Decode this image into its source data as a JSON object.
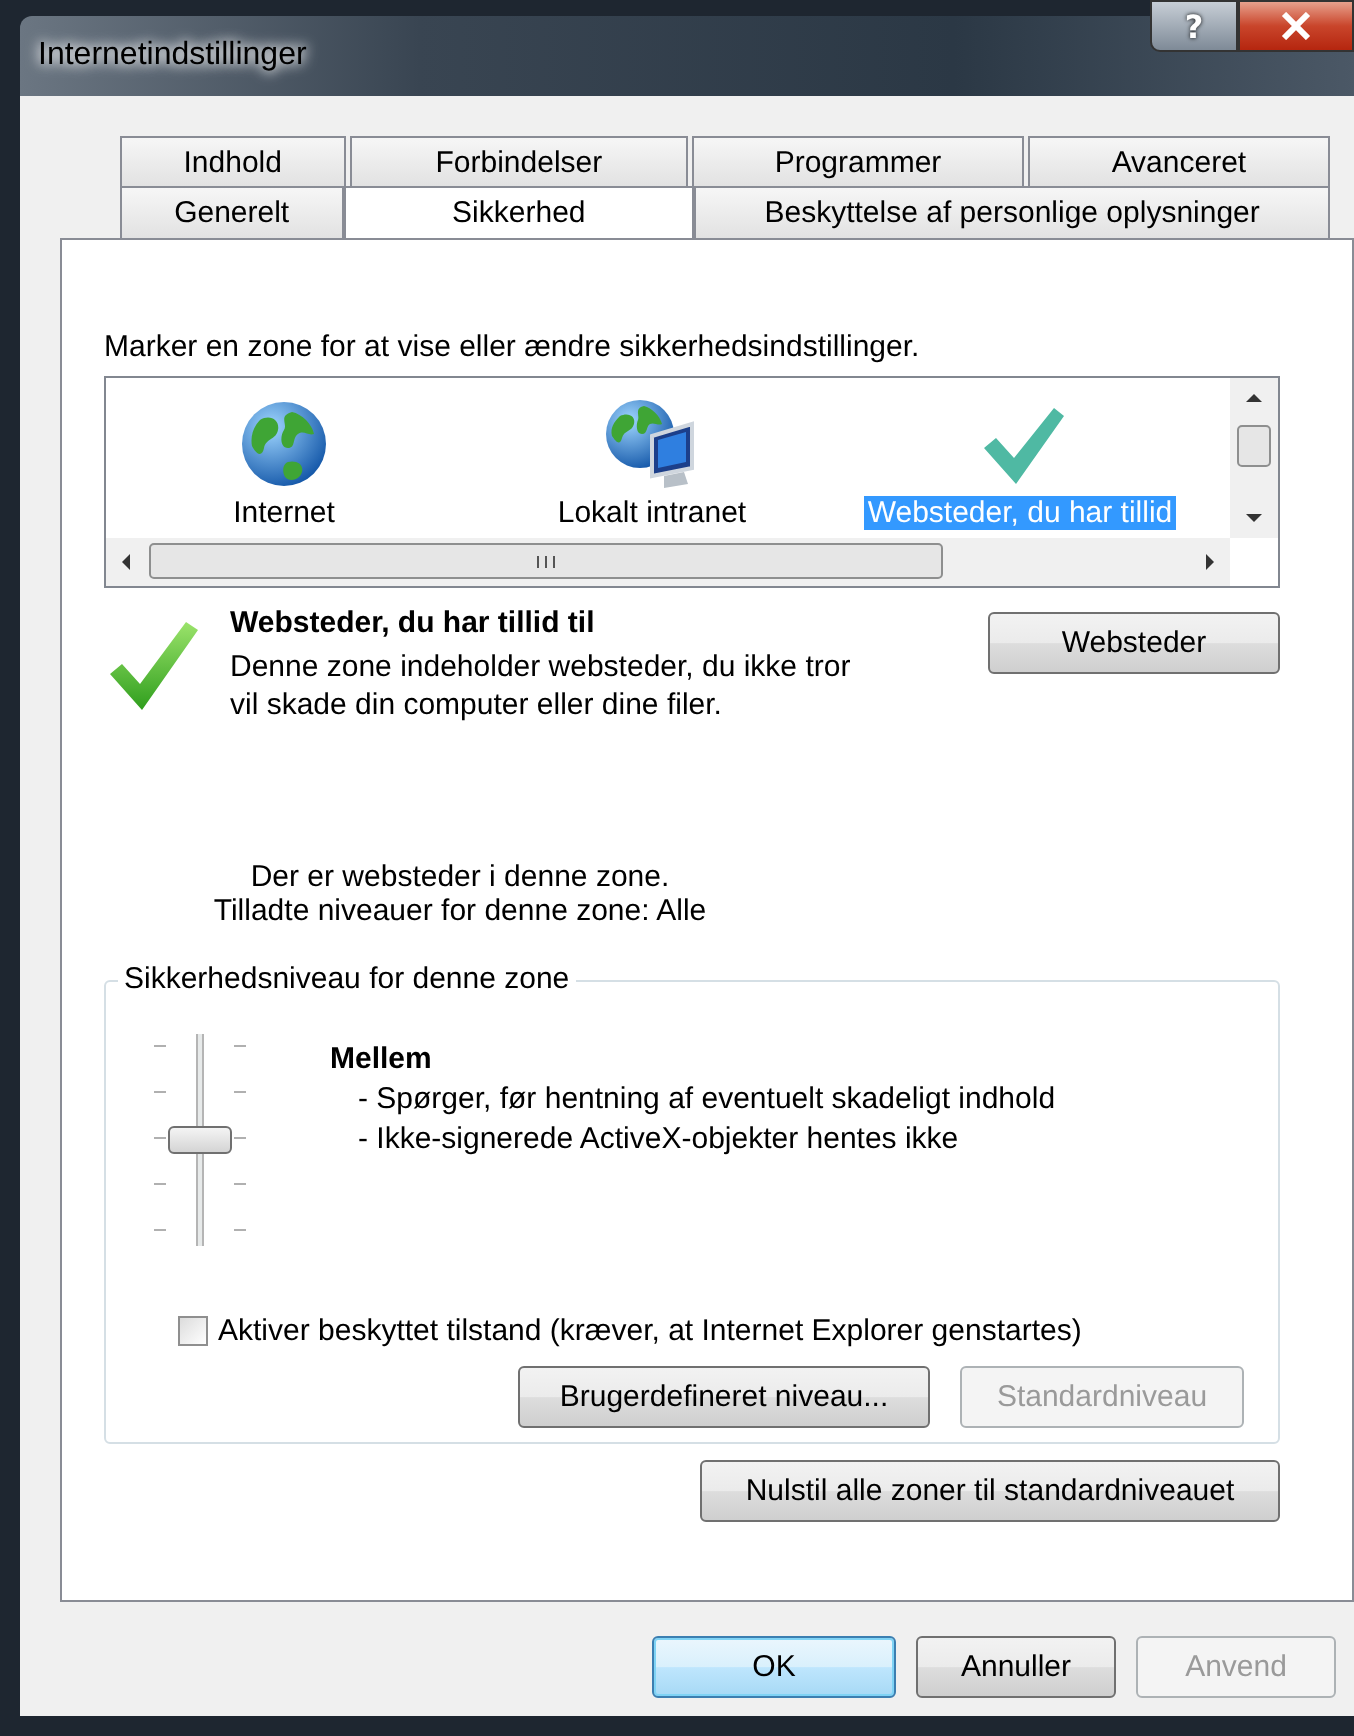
{
  "window": {
    "title": "Internetindstillinger",
    "help_label": "?"
  },
  "tab_rows": [
    {
      "tabs": [
        {
          "label": "Indhold",
          "selected": false
        },
        {
          "label": "Forbindelser",
          "selected": false
        },
        {
          "label": "Programmer",
          "selected": false
        },
        {
          "label": "Avanceret",
          "selected": false
        }
      ]
    },
    {
      "tabs": [
        {
          "label": "Generelt",
          "selected": false
        },
        {
          "label": "Sikkerhed",
          "selected": true
        },
        {
          "label": "Beskyttelse af personlige oplysninger",
          "selected": false
        }
      ]
    }
  ],
  "zone_prompt": "Marker en zone for at vise eller ændre sikkerhedsindstillinger.",
  "zones": [
    {
      "label": "Internet",
      "kind": "globe",
      "selected": false
    },
    {
      "label": "Lokalt intranet",
      "kind": "intranet",
      "selected": false
    },
    {
      "label": "Websteder, du har tillid",
      "kind": "check",
      "selected": true
    }
  ],
  "zone_info": {
    "title": "Websteder, du har tillid til",
    "description": "Denne zone indeholder websteder, du ikke tror vil skade din computer eller dine filer.",
    "sites_button": "Websteder",
    "status": "Der er websteder i denne zone.",
    "allowed_levels": "Tilladte niveauer for denne zone: Alle"
  },
  "security_level": {
    "group_title": "Sikkerhedsniveau for denne zone",
    "level": 0.5,
    "level_name": "Mellem",
    "details": [
      "- Spørger, før hentning af eventuelt skadeligt indhold",
      "- Ikke-signerede ActiveX-objekter hentes ikke"
    ],
    "protected_mode": {
      "label": "Aktiver beskyttet tilstand (kræver, at Internet Explorer genstartes)",
      "checked": false
    },
    "buttons": [
      {
        "label": "Brugerdefineret niveau...",
        "disabled": false
      },
      {
        "label": "Standardniveau",
        "disabled": true
      }
    ]
  },
  "reset_button": {
    "label": "Nulstil alle zoner til standardniveauet",
    "disabled": false
  },
  "buttons": [
    {
      "label": "OK",
      "default": true,
      "disabled": false
    },
    {
      "label": "Annuller",
      "default": false,
      "disabled": false
    },
    {
      "label": "Anvend",
      "default": false,
      "disabled": true
    }
  ]
}
